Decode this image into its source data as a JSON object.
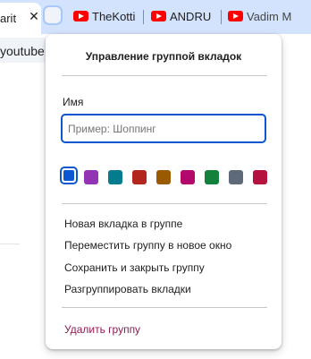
{
  "tabs": {
    "active_title": "arit",
    "close_glyph": "✕",
    "items": [
      {
        "title": "TheKotti",
        "icon": "youtube-icon"
      },
      {
        "title": "ANDRU",
        "icon": "youtube-icon"
      },
      {
        "title": "Vadim M",
        "icon": "youtube-icon"
      }
    ]
  },
  "omnibox": {
    "text": "youtube"
  },
  "dialog": {
    "title": "Управление группой вкладок",
    "name_label": "Имя",
    "name_value": "",
    "name_placeholder": "Пример: Шоппинг",
    "colors": [
      "#0b57d0",
      "#9334b5",
      "#057c8e",
      "#b3261e",
      "#9a5a00",
      "#b4096c",
      "#13803c",
      "#5e6a79",
      "#b3133e"
    ],
    "selected_color": "#0b57d0",
    "menu": [
      "Новая вкладка в группе",
      "Переместить группу в новое окно",
      "Сохранить и закрыть группу",
      "Разгруппировать вкладки"
    ],
    "delete_label": "Удалить группу"
  }
}
